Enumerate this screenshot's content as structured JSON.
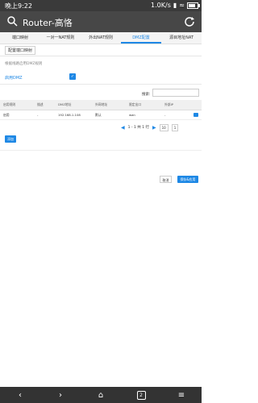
{
  "status_bar": {
    "time": "晚上9:22",
    "network_speed": "1.0K/s",
    "battery_level": 0.8
  },
  "appbar": {
    "title": "Router-高恪"
  },
  "tabs": [
    {
      "label": "端口映射"
    },
    {
      "label": "一对一NAT规则"
    },
    {
      "label": "外出NAT规则"
    },
    {
      "label": "DMZ配置"
    },
    {
      "label": "源目地址NAT"
    }
  ],
  "subtab": {
    "label": "配置端口映射"
  },
  "dmz": {
    "description": "根据线路启用DMZ规则",
    "enable_label": "启用DMZ",
    "enabled": true
  },
  "search": {
    "label": "搜索:",
    "placeholder": ""
  },
  "table": {
    "headers": [
      "启用规则",
      "描述",
      "DMZ地址",
      "外网地址",
      "限定出口",
      "外部IP",
      ""
    ],
    "rows": [
      [
        "启用",
        "-",
        "192.168.1.108",
        "默认",
        "wan",
        "-"
      ]
    ]
  },
  "pager": {
    "range": "1 - 1 共 1 行",
    "page_size": "10",
    "page": "1"
  },
  "buttons": {
    "add": "添加",
    "cancel": "取消",
    "save_apply": "保存&应用"
  },
  "colors": {
    "accent": "#1E88E5",
    "appbar": "#474747"
  }
}
